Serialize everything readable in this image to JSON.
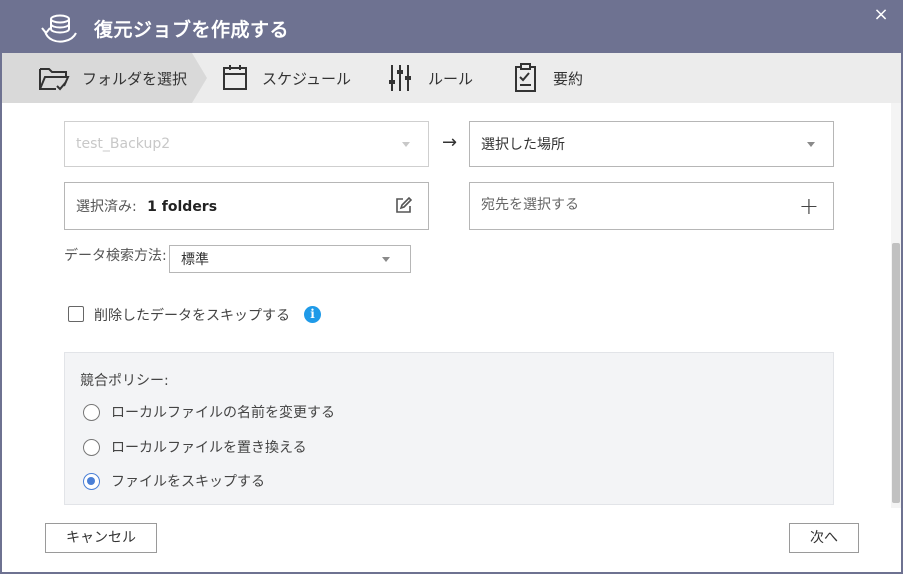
{
  "dialog": {
    "title": "復元ジョブを作成する",
    "close_symbol": "×"
  },
  "steps": [
    {
      "label": "フォルダを選択",
      "icon": "folder-check-icon",
      "active": true
    },
    {
      "label": "スケジュール",
      "icon": "calendar-icon",
      "active": false
    },
    {
      "label": "ルール",
      "icon": "sliders-icon",
      "active": false
    },
    {
      "label": "要約",
      "icon": "clipboard-check-icon",
      "active": false
    }
  ],
  "source": {
    "selected_value": "test_Backup2",
    "arrow": "→",
    "selected_prefix": "選択済み:",
    "selected_count": "1 folders"
  },
  "destination": {
    "location_value": "選択した場所",
    "select_placeholder": "宛先を選択する",
    "add_symbol": "+"
  },
  "search_method": {
    "label": "データ検索方法:",
    "value": "標準"
  },
  "skip_deleted": {
    "label": "削除したデータをスキップする",
    "checked": false,
    "info_symbol": "i"
  },
  "conflict_policy": {
    "title": "競合ポリシー:",
    "options": [
      {
        "label": "ローカルファイルの名前を変更する",
        "checked": false
      },
      {
        "label": "ローカルファイルを置き換える",
        "checked": false
      },
      {
        "label": "ファイルをスキップする",
        "checked": true
      }
    ]
  },
  "footer": {
    "cancel_label": "キャンセル",
    "next_label": "次へ"
  },
  "colors": {
    "titlebar": "#6e7291",
    "accent": "#4a7fd6",
    "info": "#1f9ae8"
  }
}
